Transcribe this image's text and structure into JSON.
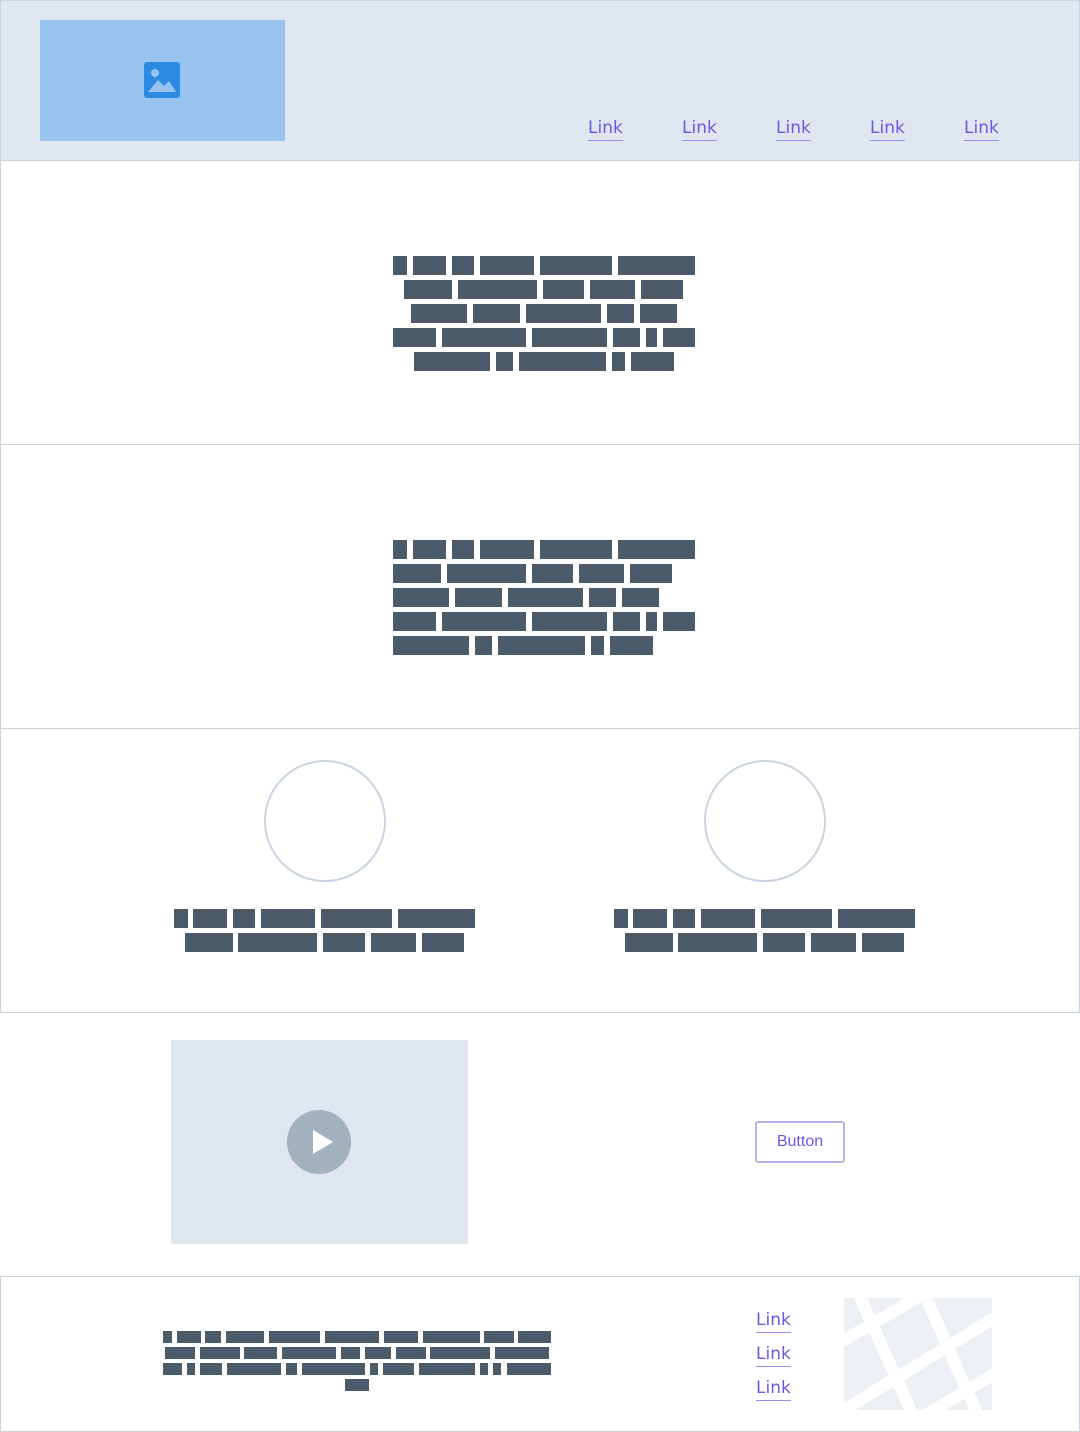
{
  "header": {
    "logo_icon": "image-icon",
    "nav_links": [
      "Link",
      "Link",
      "Link",
      "Link",
      "Link"
    ]
  },
  "media": {
    "play_icon": "play-icon",
    "button_label": "Button"
  },
  "footer": {
    "links": [
      "Link",
      "Link",
      "Link"
    ],
    "map_icon": "map-placeholder"
  },
  "colors": {
    "header_bg": "#dfe6ef",
    "logo_bg": "#98c3ee",
    "link": "#6b59e0",
    "text_block": "#4b5b6a",
    "border": "#c9d3de"
  }
}
